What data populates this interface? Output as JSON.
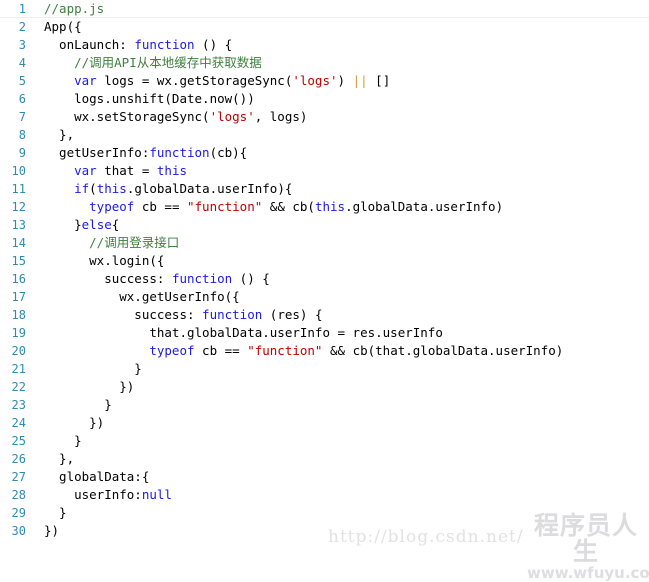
{
  "editor": {
    "language": "JavaScript",
    "filename": "app.js",
    "colors": {
      "background": "#ffffff",
      "line_number": "#2e8bb4",
      "plain": "#000000",
      "keyword": "#1a1ae6",
      "comment": "#3f7f3f",
      "string": "#c00000",
      "operator": "#d49a3a",
      "separator_rule": "#eeeeee"
    },
    "first_line_number": 1,
    "last_line_number": 30,
    "lines": [
      {
        "number": "1",
        "ruled": true,
        "tokens": [
          {
            "t": "comment",
            "s": "//app.js"
          }
        ]
      },
      {
        "number": "2",
        "ruled": false,
        "tokens": [
          {
            "t": "plain",
            "s": "App({"
          }
        ]
      },
      {
        "number": "3",
        "ruled": false,
        "tokens": [
          {
            "t": "plain",
            "s": "  onLaunch: "
          },
          {
            "t": "keyword",
            "s": "function"
          },
          {
            "t": "plain",
            "s": " () {"
          }
        ]
      },
      {
        "number": "4",
        "ruled": false,
        "tokens": [
          {
            "t": "plain",
            "s": "    "
          },
          {
            "t": "comment",
            "s": "//调用API从本地缓存中获取数据"
          }
        ]
      },
      {
        "number": "5",
        "ruled": false,
        "tokens": [
          {
            "t": "plain",
            "s": "    "
          },
          {
            "t": "keyword",
            "s": "var"
          },
          {
            "t": "plain",
            "s": " logs = wx.getStorageSync("
          },
          {
            "t": "string",
            "s": "'logs'"
          },
          {
            "t": "plain",
            "s": ") "
          },
          {
            "t": "operator",
            "s": "||"
          },
          {
            "t": "plain",
            "s": " []"
          }
        ]
      },
      {
        "number": "6",
        "ruled": false,
        "tokens": [
          {
            "t": "plain",
            "s": "    logs.unshift(Date.now())"
          }
        ]
      },
      {
        "number": "7",
        "ruled": false,
        "tokens": [
          {
            "t": "plain",
            "s": "    wx.setStorageSync("
          },
          {
            "t": "string",
            "s": "'logs'"
          },
          {
            "t": "plain",
            "s": ", logs)"
          }
        ]
      },
      {
        "number": "8",
        "ruled": false,
        "tokens": [
          {
            "t": "plain",
            "s": "  },"
          }
        ]
      },
      {
        "number": "9",
        "ruled": false,
        "tokens": [
          {
            "t": "plain",
            "s": "  getUserInfo:"
          },
          {
            "t": "keyword",
            "s": "function"
          },
          {
            "t": "plain",
            "s": "(cb){"
          }
        ]
      },
      {
        "number": "10",
        "ruled": false,
        "tokens": [
          {
            "t": "plain",
            "s": "    "
          },
          {
            "t": "keyword",
            "s": "var"
          },
          {
            "t": "plain",
            "s": " that = "
          },
          {
            "t": "keyword",
            "s": "this"
          }
        ]
      },
      {
        "number": "11",
        "ruled": false,
        "tokens": [
          {
            "t": "plain",
            "s": "    "
          },
          {
            "t": "keyword",
            "s": "if"
          },
          {
            "t": "plain",
            "s": "("
          },
          {
            "t": "keyword",
            "s": "this"
          },
          {
            "t": "plain",
            "s": ".globalData.userInfo){"
          }
        ]
      },
      {
        "number": "12",
        "ruled": false,
        "tokens": [
          {
            "t": "plain",
            "s": "      "
          },
          {
            "t": "keyword",
            "s": "typeof"
          },
          {
            "t": "plain",
            "s": " cb == "
          },
          {
            "t": "string",
            "s": "\"function\""
          },
          {
            "t": "plain",
            "s": " && cb("
          },
          {
            "t": "keyword",
            "s": "this"
          },
          {
            "t": "plain",
            "s": ".globalData.userInfo)"
          }
        ]
      },
      {
        "number": "13",
        "ruled": false,
        "tokens": [
          {
            "t": "plain",
            "s": "    }"
          },
          {
            "t": "keyword",
            "s": "else"
          },
          {
            "t": "plain",
            "s": "{"
          }
        ]
      },
      {
        "number": "14",
        "ruled": false,
        "tokens": [
          {
            "t": "plain",
            "s": "      "
          },
          {
            "t": "comment",
            "s": "//调用登录接口"
          }
        ]
      },
      {
        "number": "15",
        "ruled": false,
        "tokens": [
          {
            "t": "plain",
            "s": "      wx.login({"
          }
        ]
      },
      {
        "number": "16",
        "ruled": false,
        "tokens": [
          {
            "t": "plain",
            "s": "        success: "
          },
          {
            "t": "keyword",
            "s": "function"
          },
          {
            "t": "plain",
            "s": " () {"
          }
        ]
      },
      {
        "number": "17",
        "ruled": false,
        "tokens": [
          {
            "t": "plain",
            "s": "          wx.getUserInfo({"
          }
        ]
      },
      {
        "number": "18",
        "ruled": false,
        "tokens": [
          {
            "t": "plain",
            "s": "            success: "
          },
          {
            "t": "keyword",
            "s": "function"
          },
          {
            "t": "plain",
            "s": " (res) {"
          }
        ]
      },
      {
        "number": "19",
        "ruled": false,
        "tokens": [
          {
            "t": "plain",
            "s": "              that.globalData.userInfo = res.userInfo"
          }
        ]
      },
      {
        "number": "20",
        "ruled": false,
        "tokens": [
          {
            "t": "plain",
            "s": "              "
          },
          {
            "t": "keyword",
            "s": "typeof"
          },
          {
            "t": "plain",
            "s": " cb == "
          },
          {
            "t": "string",
            "s": "\"function\""
          },
          {
            "t": "plain",
            "s": " && cb(that.globalData.userInfo)"
          }
        ]
      },
      {
        "number": "21",
        "ruled": false,
        "tokens": [
          {
            "t": "plain",
            "s": "            }"
          }
        ]
      },
      {
        "number": "22",
        "ruled": false,
        "tokens": [
          {
            "t": "plain",
            "s": "          })"
          }
        ]
      },
      {
        "number": "23",
        "ruled": false,
        "tokens": [
          {
            "t": "plain",
            "s": "        }"
          }
        ]
      },
      {
        "number": "24",
        "ruled": false,
        "tokens": [
          {
            "t": "plain",
            "s": "      })"
          }
        ]
      },
      {
        "number": "25",
        "ruled": false,
        "tokens": [
          {
            "t": "plain",
            "s": "    }"
          }
        ]
      },
      {
        "number": "26",
        "ruled": false,
        "tokens": [
          {
            "t": "plain",
            "s": "  },"
          }
        ]
      },
      {
        "number": "27",
        "ruled": false,
        "tokens": [
          {
            "t": "plain",
            "s": "  globalData:{"
          }
        ]
      },
      {
        "number": "28",
        "ruled": false,
        "tokens": [
          {
            "t": "plain",
            "s": "    userInfo:"
          },
          {
            "t": "keyword",
            "s": "null"
          }
        ]
      },
      {
        "number": "29",
        "ruled": false,
        "tokens": [
          {
            "t": "plain",
            "s": "  }"
          }
        ]
      },
      {
        "number": "30",
        "ruled": false,
        "tokens": [
          {
            "t": "plain",
            "s": "})"
          }
        ]
      }
    ]
  },
  "watermarks": {
    "url": "http://blog.csdn.net/",
    "logo_cn": "程序员人生",
    "logo_site": "www.wfuyu.com"
  }
}
